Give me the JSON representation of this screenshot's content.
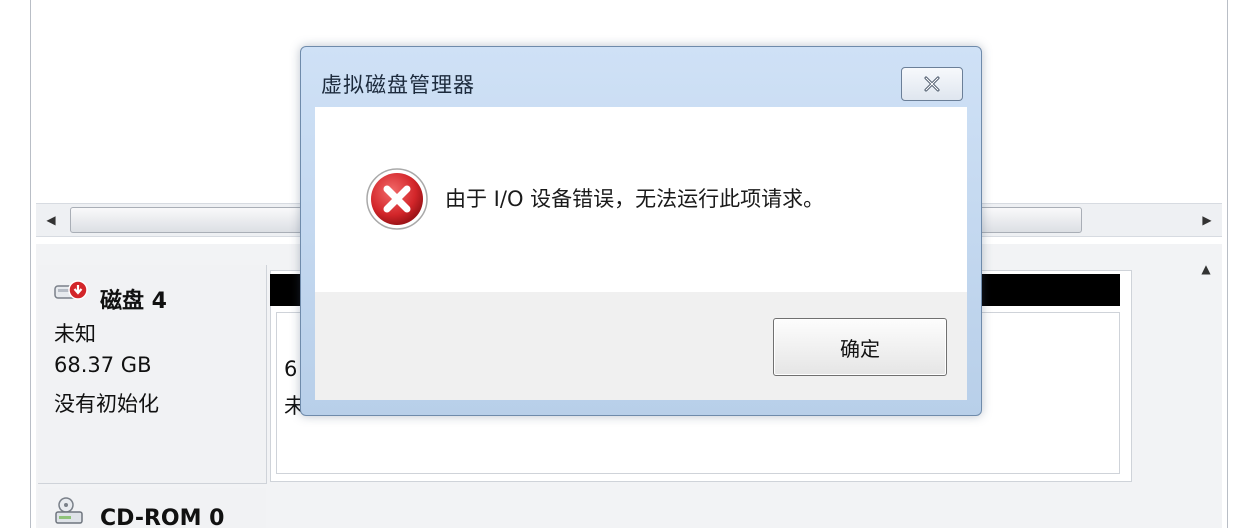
{
  "dialog": {
    "title": "虚拟磁盘管理器",
    "message": "由于 I/O 设备错误，无法运行此项请求。",
    "ok_label": "确定"
  },
  "disks": [
    {
      "name": "磁盘 4",
      "type": "未知",
      "size": "68.37 GB",
      "status": "没有初始化",
      "partition": {
        "size_partial": "6",
        "state_partial": "未"
      }
    },
    {
      "name": "CD-ROM 0"
    }
  ],
  "icons": {
    "error": "error-icon",
    "close": "close-icon",
    "disk": "disk-warning-icon",
    "cdrom": "cdrom-icon",
    "scroll_left": "scroll-left-icon",
    "scroll_right": "scroll-right-icon",
    "scroll_up": "scroll-up-icon"
  },
  "colors": {
    "dialog_frame": "#cfe1f6",
    "error_red": "#d3262a",
    "partition_header": "#000000"
  }
}
